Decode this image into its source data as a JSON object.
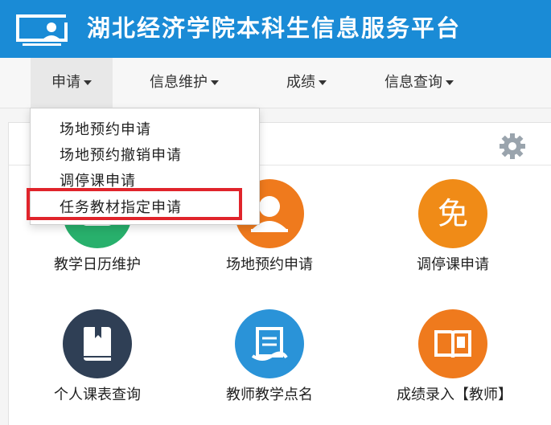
{
  "header": {
    "title": "湖北经济学院本科生信息服务平台",
    "color": "#1a8bd6"
  },
  "nav": {
    "items": [
      {
        "label": "申请"
      },
      {
        "label": "信息维护"
      },
      {
        "label": "成绩"
      },
      {
        "label": "信息查询"
      }
    ]
  },
  "dropdown": {
    "items": [
      {
        "label": "场地预约申请"
      },
      {
        "label": "场地预约撤销申请"
      },
      {
        "label": "调停课申请"
      },
      {
        "label": "任务教材指定申请"
      }
    ],
    "highlight_color": "#e0242b"
  },
  "tiles": [
    {
      "label": "教学日历维护",
      "icon": "calendar-icon",
      "color": "#28b06c"
    },
    {
      "label": "场地预约申请",
      "icon": "user-icon",
      "color": "#ef7a1d"
    },
    {
      "label": "调停课申请",
      "icon": "mian-glyph-icon",
      "glyph": "免",
      "color": "#f08b17"
    },
    {
      "label": "个人课表查询",
      "icon": "book-icon",
      "color": "#2f3f55"
    },
    {
      "label": "教师教学点名",
      "icon": "checklist-icon",
      "color": "#2a93d8"
    },
    {
      "label": "成绩录入【教师】",
      "icon": "open-book-icon",
      "color": "#ef7a1d"
    }
  ]
}
